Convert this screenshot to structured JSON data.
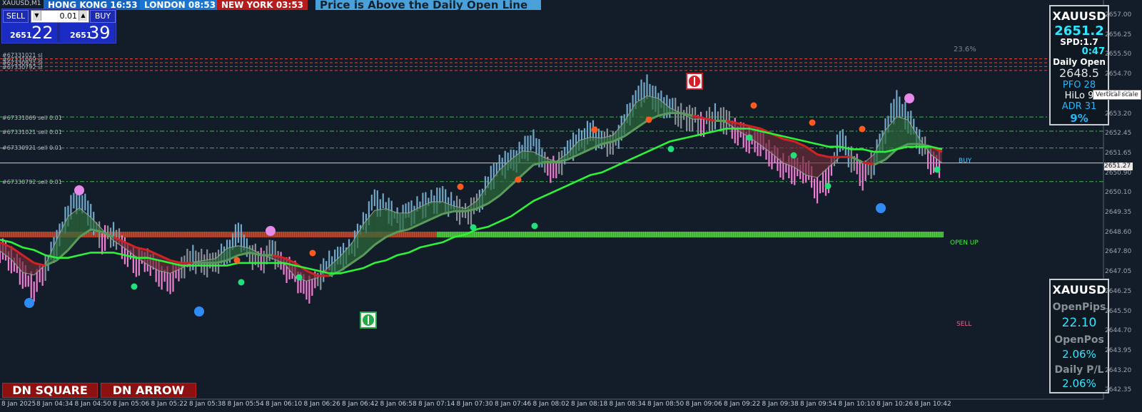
{
  "symbol_title": "XAUUSD,M1",
  "sessions": [
    {
      "label": "HONG KONG 16:53",
      "color": "#1565c0"
    },
    {
      "label": "LONDON   08:53",
      "color": "#1976d2"
    },
    {
      "label": "NEW YORK  03:53",
      "color": "#b71c1c"
    }
  ],
  "banner": "Price is Above the Daily Open Line",
  "trade_panel": {
    "sell_label": "SELL",
    "buy_label": "BUY",
    "lot": "0.01",
    "sell_price_small": "2651",
    "sell_price_big": "22",
    "buy_price_small": "2651",
    "buy_price_big": "39"
  },
  "info_top": {
    "symbol": "XAUUSD",
    "price": "2651.2",
    "spread": "SPD:1.7",
    "timer": "0:47",
    "daily_open_label": "Daily Open",
    "daily_open_value": "2648.5",
    "pfo": "PFO  28",
    "hilo": "HiLo  9",
    "adr": "ADR 31",
    "pct": "9%"
  },
  "tooltip": "Vertical scale",
  "info_bottom": {
    "symbol": "XAUUSD",
    "open_pips_label": "OpenPips",
    "open_pips_value": "22.10",
    "open_pos_label": "OpenPos",
    "open_pos_value": "2.06%",
    "daily_pl_label": "Daily P/L",
    "daily_pl_value": "2.06%"
  },
  "fib_label": "23.6%",
  "right_labels": {
    "buy": "BUY",
    "open_up": "OPEN UP",
    "sell": "SELL"
  },
  "current_price_tag": "2651.27",
  "price_axis": [
    "2657.00",
    "2656.25",
    "2655.50",
    "2654.70",
    "2653.95",
    "2653.20",
    "2652.45",
    "2651.65",
    "2650.90",
    "2650.10",
    "2649.35",
    "2648.60",
    "2647.80",
    "2647.05",
    "2646.25",
    "2645.50",
    "2644.70",
    "2643.95",
    "2643.20",
    "2642.35"
  ],
  "time_axis": [
    "8 Jan 2025",
    "8 Jan 04:34",
    "8 Jan 04:50",
    "8 Jan 05:06",
    "8 Jan 05:22",
    "8 Jan 05:38",
    "8 Jan 05:54",
    "8 Jan 06:10",
    "8 Jan 06:26",
    "8 Jan 06:42",
    "8 Jan 06:58",
    "8 Jan 07:14",
    "8 Jan 07:30",
    "8 Jan 07:46",
    "8 Jan 08:02",
    "8 Jan 08:18",
    "8 Jan 08:34",
    "8 Jan 08:50",
    "8 Jan 09:06",
    "8 Jan 09:22",
    "8 Jan 09:38",
    "8 Jan 09:54",
    "8 Jan 10:10",
    "8 Jan 10:26",
    "8 Jan 10:42"
  ],
  "order_labels_red": [
    "#67331021 sl",
    "#67331069 sl",
    "#67330921 sl",
    "#67330792 sl"
  ],
  "order_labels_green": [
    "#67331069 sell 0.01",
    "#67331021 sell 0.01",
    "#67330921 sell 0.01",
    "#67330792 sell 0.01"
  ],
  "bottom_buttons": [
    "DN SQUARE",
    "DN ARROW"
  ],
  "chart_data": {
    "type": "line",
    "series": [
      {
        "values": [
          2648.0,
          2647.6,
          2647.0,
          2646.5,
          2647.3,
          2648.2,
          2649.4,
          2650.0,
          2649.2,
          2648.3,
          2648.6,
          2647.9,
          2647.4,
          2647.6,
          2647.0,
          2646.7,
          2647.3,
          2647.6,
          2647.4,
          2647.5,
          2647.8,
          2648.6,
          2647.8,
          2647.5,
          2647.9,
          2647.3,
          2647.0,
          2646.3,
          2646.8,
          2647.4,
          2647.6,
          2648.0,
          2648.9,
          2649.8,
          2649.6,
          2649.1,
          2649.3,
          2649.6,
          2649.8,
          2649.9,
          2649.6,
          2649.3,
          2649.6,
          2650.5,
          2651.2,
          2651.3,
          2651.7,
          2652.2,
          2651.2,
          2651.0,
          2651.8,
          2652.1,
          2652.5,
          2652.2,
          2652.0,
          2652.8,
          2653.8,
          2654.2,
          2653.6,
          2653.5,
          2653.1,
          2653.0,
          2652.8,
          2653.1,
          2652.9,
          2652.5,
          2652.2,
          2652.1,
          2651.6,
          2651.2,
          2651.0,
          2651.1,
          2650.3,
          2650.7,
          2652.3,
          2651.5,
          2650.8,
          2651.4,
          2652.6,
          2653.6,
          2653.0,
          2652.2,
          2651.4,
          2651.2
        ],
        "color": "#6fa8c8"
      },
      {
        "values": [
          2648.2,
          2648.0,
          2647.7,
          2647.4,
          2647.3,
          2647.5,
          2647.9,
          2648.4,
          2648.7,
          2648.6,
          2648.4,
          2648.2,
          2648.0,
          2647.9,
          2647.7,
          2647.5,
          2647.4,
          2647.4,
          2647.4,
          2647.4,
          2647.5,
          2647.7,
          2647.8,
          2647.7,
          2647.7,
          2647.6,
          2647.4,
          2647.1,
          2646.9,
          2646.9,
          2647.1,
          2647.4,
          2647.7,
          2648.1,
          2648.4,
          2648.6,
          2648.7,
          2648.9,
          2649.1,
          2649.3,
          2649.4,
          2649.4,
          2649.5,
          2649.7,
          2650.0,
          2650.4,
          2650.8,
          2651.2,
          2651.3,
          2651.3,
          2651.4,
          2651.6,
          2651.8,
          2652.0,
          2652.1,
          2652.3,
          2652.6,
          2652.9,
          2653.1,
          2653.2,
          2653.2,
          2653.1,
          2653.0,
          2652.9,
          2652.9,
          2652.8,
          2652.7,
          2652.6,
          2652.4,
          2652.2,
          2652.1,
          2651.9,
          2651.6,
          2651.5,
          2651.5,
          2651.5,
          2651.3,
          2651.2,
          2651.4,
          2651.8,
          2652.0,
          2652.0,
          2651.9,
          2651.7
        ],
        "color": "#c62828"
      },
      {
        "values": [
          2648.3,
          2648.2,
          2648.0,
          2647.9,
          2647.7,
          2647.6,
          2647.6,
          2647.7,
          2647.8,
          2647.8,
          2647.8,
          2647.7,
          2647.6,
          2647.6,
          2647.5,
          2647.4,
          2647.3,
          2647.3,
          2647.3,
          2647.3,
          2647.3,
          2647.4,
          2647.4,
          2647.4,
          2647.4,
          2647.4,
          2647.3,
          2647.2,
          2647.1,
          2647.0,
          2647.0,
          2647.1,
          2647.2,
          2647.4,
          2647.5,
          2647.7,
          2647.8,
          2648.0,
          2648.1,
          2648.2,
          2648.4,
          2648.5,
          2648.7,
          2648.8,
          2649.0,
          2649.2,
          2649.5,
          2649.8,
          2650.0,
          2650.2,
          2650.4,
          2650.6,
          2650.8,
          2650.9,
          2651.1,
          2651.3,
          2651.5,
          2651.7,
          2651.9,
          2652.1,
          2652.2,
          2652.3,
          2652.4,
          2652.5,
          2652.6,
          2652.6,
          2652.6,
          2652.5,
          2652.4,
          2652.3,
          2652.2,
          2652.1,
          2652.0,
          2651.9,
          2651.9,
          2651.8,
          2651.8,
          2651.7,
          2651.7,
          2651.8,
          2651.9,
          2651.9,
          2651.9,
          2651.8
        ],
        "color": "#2ef23a"
      }
    ],
    "daily_open_level": 2648.5,
    "current_price": 2651.27,
    "ylim": [
      2642.35,
      2657.3
    ]
  }
}
